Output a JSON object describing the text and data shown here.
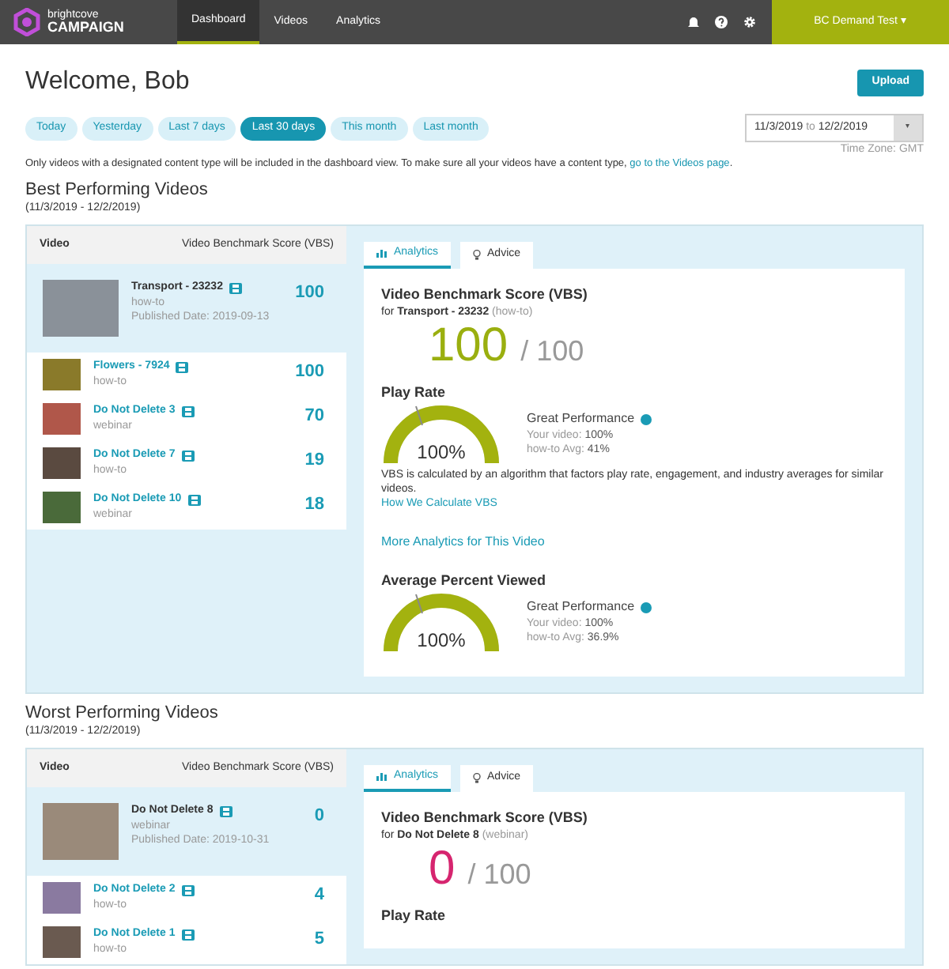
{
  "nav": {
    "logo_top": "brightcove",
    "logo_bottom": "CAMPAIGN",
    "tabs": [
      {
        "label": "Dashboard",
        "selected": true
      },
      {
        "label": "Videos",
        "selected": false
      },
      {
        "label": "Analytics",
        "selected": false
      }
    ],
    "account": "BC Demand Test ▾"
  },
  "header": {
    "title": "Welcome, Bob",
    "upload": "Upload"
  },
  "ranges": [
    {
      "label": "Today",
      "selected": false
    },
    {
      "label": "Yesterday",
      "selected": false
    },
    {
      "label": "Last 7 days",
      "selected": false
    },
    {
      "label": "Last 30 days",
      "selected": true
    },
    {
      "label": "This month",
      "selected": false
    },
    {
      "label": "Last month",
      "selected": false
    }
  ],
  "date_range": {
    "from": "11/3/2019",
    "separator": "to",
    "to": "12/2/2019",
    "caret": "▾",
    "timezone": "Time Zone: GMT"
  },
  "notice": {
    "text": "Only videos with a designated content type will be included in the dashboard view. To make sure all your videos have a content type,",
    "link": "go to the Videos page",
    "end": "."
  },
  "sections": [
    {
      "title": "Best Performing Videos",
      "period": "(11/3/2019 - 12/2/2019)",
      "columns": [
        "Video",
        "Video Benchmark Score (VBS)"
      ],
      "videos": [
        {
          "title": "Transport - 23232",
          "type": "how-to",
          "published": "Published Date: 2019-09-13",
          "score": "100",
          "selected": true,
          "color": "#8a9199"
        },
        {
          "title": "Flowers - 7924",
          "type": "how-to",
          "score": "100",
          "selected": false,
          "color": "#8a7a2a"
        },
        {
          "title": "Do Not Delete 3",
          "type": "webinar",
          "score": "70",
          "selected": false,
          "color": "#b0574a"
        },
        {
          "title": "Do Not Delete 7",
          "type": "how-to",
          "score": "19",
          "selected": false,
          "color": "#5a4a40"
        },
        {
          "title": "Do Not Delete 10",
          "type": "webinar",
          "score": "18",
          "selected": false,
          "color": "#4a6a3a"
        }
      ],
      "detail": {
        "tabs": [
          {
            "label": "Analytics",
            "selected": true
          },
          {
            "label": "Advice",
            "selected": false
          }
        ],
        "heading": "Video Benchmark Score (VBS)",
        "for": "for",
        "video": "Transport - 23232",
        "type": "(how-to)",
        "score": "100",
        "out_of": "/ 100",
        "kind": "good",
        "metrics": [
          {
            "title": "Play Rate",
            "value": "100%",
            "level": 1,
            "rating": "Great Performance",
            "your_label": "Your video:",
            "your_value": "100%",
            "avg_label": "how-to Avg:",
            "avg_value": "41%"
          },
          {
            "title": "Average Percent Viewed",
            "value": "100%",
            "level": 1,
            "rating": "Great Performance",
            "your_label": "Your video:",
            "your_value": "100%",
            "avg_label": "how-to Avg:",
            "avg_value": "36.9%"
          }
        ],
        "note": "VBS is calculated by an algorithm that factors play rate, engagement, and industry averages for similar videos.",
        "note_link": "How We Calculate VBS",
        "more_link": "More Analytics for This Video"
      }
    },
    {
      "title": "Worst Performing Videos",
      "period": "(11/3/2019 - 12/2/2019)",
      "columns": [
        "Video",
        "Video Benchmark Score (VBS)"
      ],
      "videos": [
        {
          "title": "Do Not Delete 8",
          "type": "webinar",
          "published": "Published Date: 2019-10-31",
          "score": "0",
          "selected": true,
          "color": "#9a8a7a"
        },
        {
          "title": "Do Not Delete 2",
          "type": "how-to",
          "score": "4",
          "selected": false,
          "color": "#8a7aa0"
        },
        {
          "title": "Do Not Delete 1",
          "type": "how-to",
          "score": "5",
          "selected": false,
          "color": "#6a5a50"
        }
      ],
      "detail": {
        "tabs": [
          {
            "label": "Analytics",
            "selected": true
          },
          {
            "label": "Advice",
            "selected": false
          }
        ],
        "heading": "Video Benchmark Score (VBS)",
        "for": "for",
        "video": "Do Not Delete 8",
        "type": "(webinar)",
        "score": "0",
        "out_of": "/ 100",
        "kind": "bad",
        "metrics": [
          {
            "title": "Play Rate"
          }
        ]
      }
    }
  ]
}
